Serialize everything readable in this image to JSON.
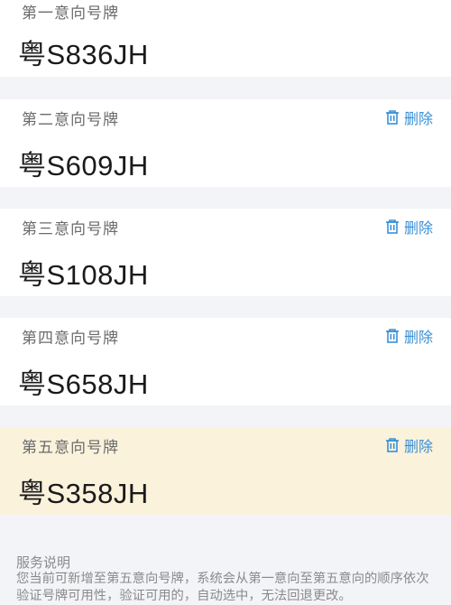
{
  "plates": [
    {
      "label": "第一意向号牌",
      "plate": "粤S836JH",
      "delete_label": ""
    },
    {
      "label": "第二意向号牌",
      "plate": "粤S609JH",
      "delete_label": "删除"
    },
    {
      "label": "第三意向号牌",
      "plate": "粤S108JH",
      "delete_label": "删除"
    },
    {
      "label": "第四意向号牌",
      "plate": "粤S658JH",
      "delete_label": "删除"
    },
    {
      "label": "第五意向号牌",
      "plate": "粤S358JH",
      "delete_label": "删除"
    }
  ],
  "service": {
    "title": "服务说明",
    "line1": "您当前可新增至第五意向号牌，系统会从第一意向至第五意向的顺序依次",
    "line2": "验证号牌可用性，验证可用的，自动选中，无法回退更改。"
  },
  "colors": {
    "accent": "#3a8fd6",
    "highlight_bg": "#fbf2dc",
    "page_bg": "#f2f4f7"
  },
  "icons": {
    "delete": "trash-icon"
  }
}
